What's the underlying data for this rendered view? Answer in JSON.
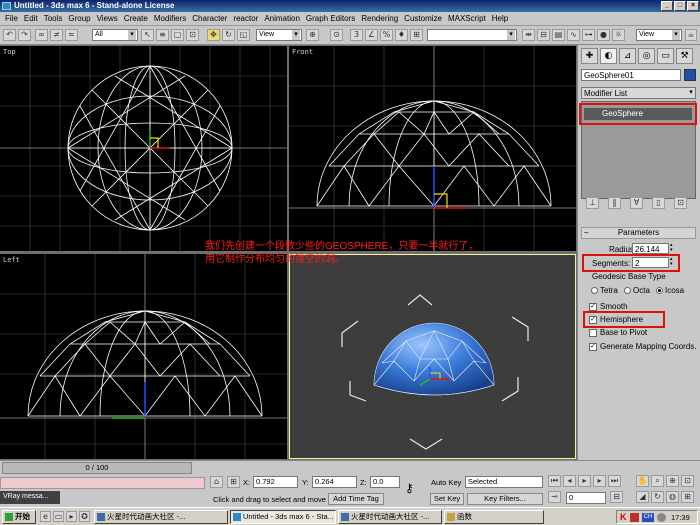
{
  "window": {
    "title": "Untitled - 3ds max 6 - Stand-alone License"
  },
  "menu": [
    "File",
    "Edit",
    "Tools",
    "Group",
    "Views",
    "Create",
    "Modifiers",
    "Character",
    "reactor",
    "Animation",
    "Graph Editors",
    "Rendering",
    "Customize",
    "MAXScript",
    "Help"
  ],
  "toolbar": {
    "selection_filter": "All",
    "coord_system_1": "View",
    "coord_system_2": "View"
  },
  "viewports": {
    "top": "Top",
    "front": "Front",
    "left": "Left"
  },
  "annotation": {
    "line1": "我们先创建一个段数少些的GEOSPHERE，只要一半就行了，",
    "line2": "用它制作分布均匀的镂空的洞。"
  },
  "panel": {
    "object_name": "GeoSphere01",
    "object_color": "#1f4fa8",
    "modifier_list": "Modifier List",
    "stack_item": "GeoSphere",
    "rollout_title": "Parameters",
    "radius_label": "Radius:",
    "radius_value": "26.144",
    "segments_label": "Segments:",
    "segments_value": "2",
    "base_type_label": "Geodesic Base Type",
    "base_types": [
      "Tetra",
      "Octa",
      "Icosa"
    ],
    "base_type_selected": "Icosa",
    "smooth": "Smooth",
    "hemisphere": "Hemisphere",
    "base_to_pivot": "Base to Pivot",
    "gen_mapping": "Generate Mapping Coords."
  },
  "status": {
    "frame": "0 / 100",
    "x_label": "X:",
    "x_value": "0.792",
    "y_label": "Y:",
    "y_value": "0.264",
    "z_label": "Z:",
    "z_value": "0.0",
    "prompt": "Click and drag to select and move",
    "add_time_tag": "Add Time Tag",
    "auto_key": "Auto Key",
    "set_key": "Set Key",
    "key_mode": "Selected",
    "key_filters": "Key Filters...",
    "frame_field": "0",
    "vray": "VRay messa..."
  },
  "taskbar": {
    "start": "开始",
    "tasks": [
      "火星时代动画大社区 -...",
      "Untitled - 3ds max 6 - Sta...",
      "火星时代动画大社区 -...",
      "函数"
    ],
    "clock": "17:39"
  },
  "colors": {
    "accent_red": "#ff1e1e",
    "wire": "#ffffff",
    "sphere_blue": "#3b7bd8"
  }
}
